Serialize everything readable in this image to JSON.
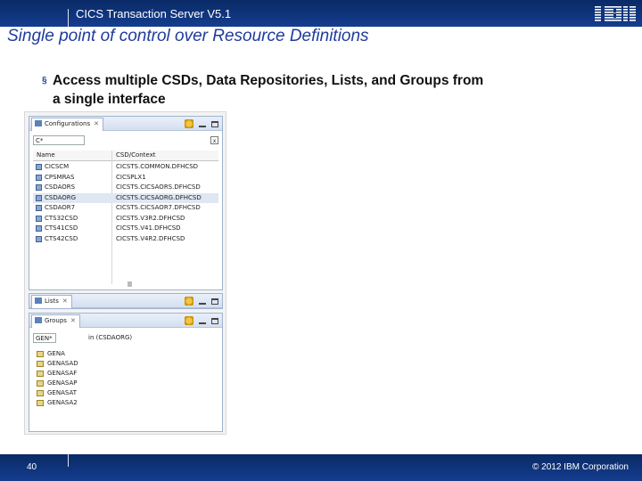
{
  "header": {
    "product": "CICS Transaction Server V5.1",
    "logo_text": "IBM",
    "colors": {
      "bar": "#0a2a66",
      "title": "#1f3c9c"
    }
  },
  "slide": {
    "title": "Single point of control over Resource Definitions",
    "bullet_line1": "Access multiple CSDs, Data Repositories, Lists, and Groups from",
    "bullet_line2": "a single interface",
    "bullet_marker": "§"
  },
  "configurations": {
    "tab_label": "Configurations",
    "filter_value": "C*",
    "columns": [
      "Name",
      "CSD/Context"
    ],
    "rows": [
      {
        "name": "CICSCM",
        "context": "CICSTS.COMMON.DFHCSD"
      },
      {
        "name": "CPSMRAS",
        "context": "CICSPLX1"
      },
      {
        "name": "CSDAORS",
        "context": "CICSTS.CICSAORS.DFHCSD"
      },
      {
        "name": "CSDAORG",
        "context": "CICSTS.CICSAORG.DFHCSD"
      },
      {
        "name": "CSDAOR7",
        "context": "CICSTS.CICSAOR7.DFHCSD"
      },
      {
        "name": "CTS32CSD",
        "context": "CICSTS.V3R2.DFHCSD"
      },
      {
        "name": "CTS41CSD",
        "context": "CICSTS.V41.DFHCSD"
      },
      {
        "name": "CTS42CSD",
        "context": "CICSTS.V4R2.DFHCSD"
      }
    ],
    "selected_index": 3
  },
  "lists": {
    "tab_label": "Lists"
  },
  "groups": {
    "tab_label": "Groups",
    "search_value": "GEN*",
    "search_suffix": "in (CSDAORG)",
    "items": [
      "GENA",
      "GENASAD",
      "GENASAF",
      "GENASAP",
      "GENASAT",
      "GENASA2"
    ]
  },
  "footer": {
    "page_number": "40",
    "copyright": "© 2012 IBM Corporation"
  }
}
